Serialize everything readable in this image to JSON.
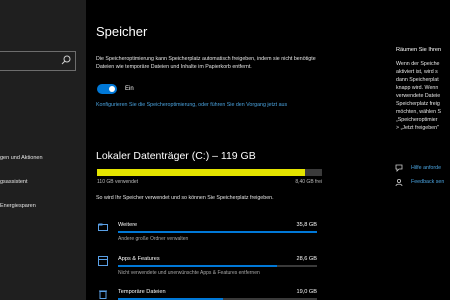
{
  "sidebar": {
    "nav_items": [
      {
        "label": "gen und Aktionen"
      },
      {
        "label": "gsassistent"
      },
      {
        "label": "Energiesparen"
      }
    ]
  },
  "main": {
    "title": "Speicher",
    "description": "Die Speicheroptimierung kann Speicherplatz automatisch freigeben, indem sie nicht benötigte Dateien wie temporäre Dateien und Inhalte im Papierkorb entfernt.",
    "toggle": {
      "state_label": "Ein",
      "on": true
    },
    "config_link": "Konfigurieren Sie die Speicheroptimierung, oder führen Sie den Vorgang jetzt aus",
    "drive": {
      "title": "Lokaler Datenträger (C:) – 119 GB",
      "used_label": "110 GB verwendet",
      "free_label": "8,40 GB frei",
      "used_fraction": 0.925,
      "bar_color": "#e4e400"
    },
    "hint": "So wird Ihr Speicher verwendet und so können Sie Speicherplatz freigeben.",
    "categories": [
      {
        "name": "Weitere",
        "size": "35,8 GB",
        "desc": "Andere große Ordner verwalten",
        "icon": "folder-icon",
        "fraction": 1.0
      },
      {
        "name": "Apps & Features",
        "size": "28,6 GB",
        "desc": "Nicht verwendete und unerwünschte Apps & Features entfernen",
        "icon": "apps-icon",
        "fraction": 0.8
      },
      {
        "name": "Temporäre Dateien",
        "size": "19,0 GB",
        "desc": "",
        "icon": "trash-icon",
        "fraction": 0.53
      }
    ],
    "accent": "#0078d7"
  },
  "right_panel": {
    "title": "Räumen Sie Ihren",
    "text_lines": "Wenn der Speiche\naktiviert ist, wird s\ndann Speicherplat\nknapp wird. Wenn\nverwendete Dateie\nSpeicherplatz freig\nmöchten, wählen S\n„Speicheroptimier\n> „Jetzt freigeben\"",
    "help_link": "Hilfe anforde",
    "feedback_link": "Feedback sen"
  }
}
